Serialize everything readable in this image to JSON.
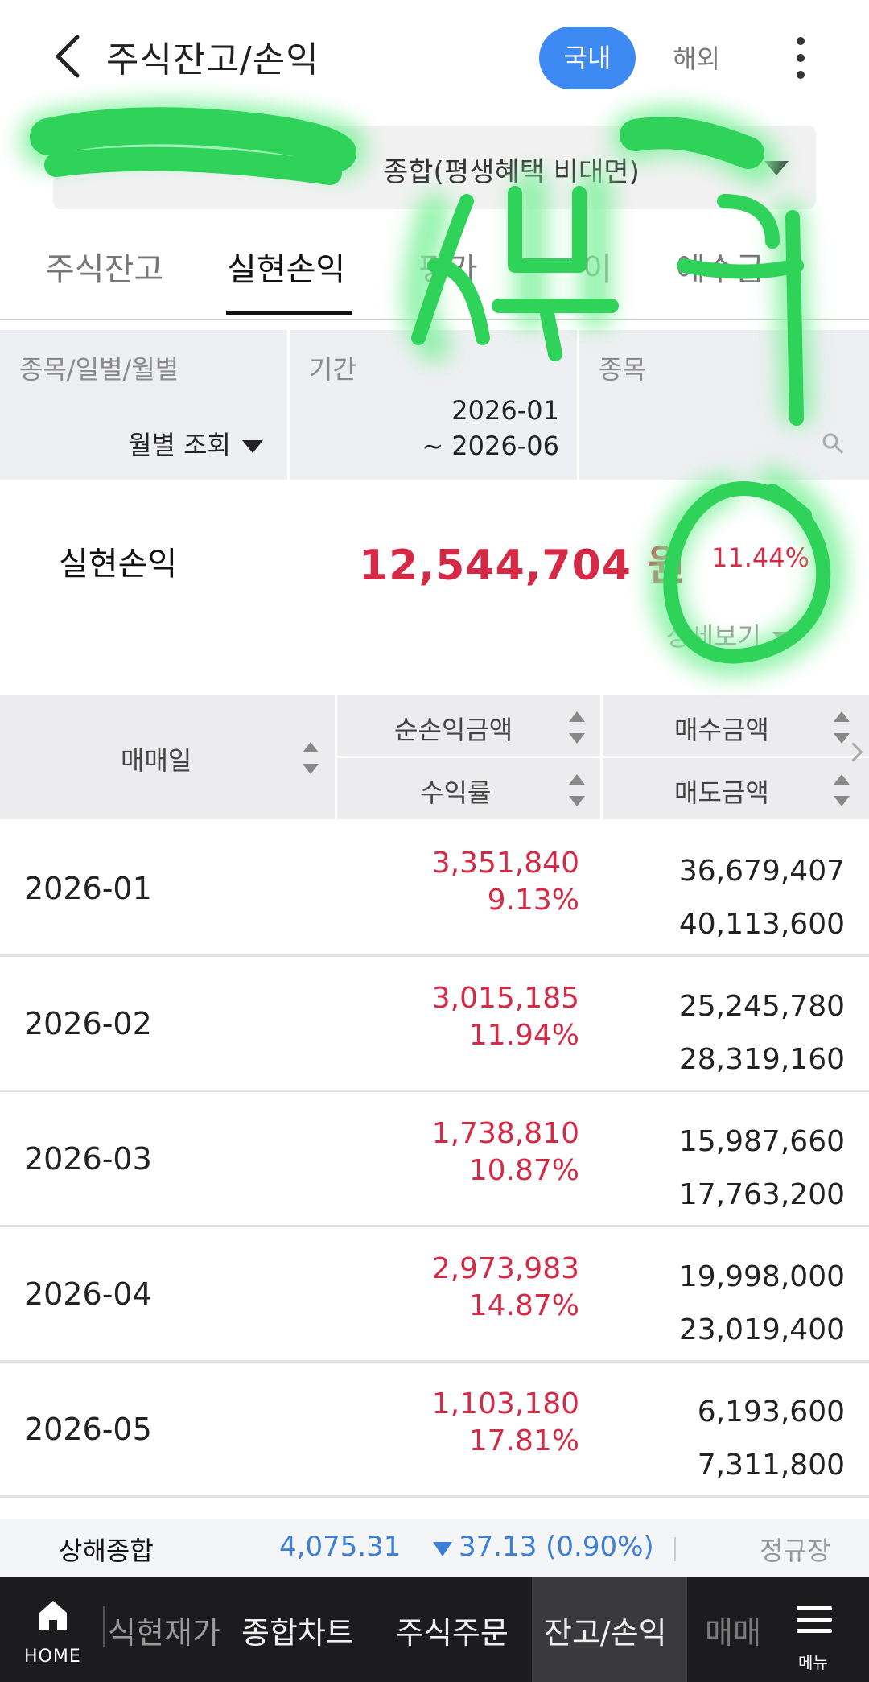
{
  "header": {
    "title": "주식잔고/손익",
    "domestic_label": "국내",
    "overseas_label": "해외"
  },
  "account": {
    "name": "종합(평생혜택 비대면)"
  },
  "tabs": [
    {
      "label": "주식잔고"
    },
    {
      "label": "실현손익"
    },
    {
      "label": "평가"
    },
    {
      "label": "이"
    },
    {
      "label": "예수금"
    }
  ],
  "filters": {
    "type_label": "종목/일별/월별",
    "type_value": "월별 조회",
    "period_label": "기간",
    "period_start": "2026-01",
    "period_end": "~ 2026-06",
    "stock_label": "종목"
  },
  "summary": {
    "label": "실현손익",
    "amount": "12,544,704 원",
    "rate": "11.44%",
    "detail_label": "상세보기"
  },
  "table": {
    "col_date": "매매일",
    "col_net_pnl": "순손익금액",
    "col_rate": "수익률",
    "col_buy": "매수금액",
    "col_sell": "매도금액",
    "rows": [
      {
        "date": "2026-01",
        "pnl": "3,351,840",
        "rate": "9.13%",
        "buy": "36,679,407",
        "sell": "40,113,600"
      },
      {
        "date": "2026-02",
        "pnl": "3,015,185",
        "rate": "11.94%",
        "buy": "25,245,780",
        "sell": "28,319,160"
      },
      {
        "date": "2026-03",
        "pnl": "1,738,810",
        "rate": "10.87%",
        "buy": "15,987,660",
        "sell": "17,763,200"
      },
      {
        "date": "2026-04",
        "pnl": "2,973,983",
        "rate": "14.87%",
        "buy": "19,998,000",
        "sell": "23,019,400"
      },
      {
        "date": "2026-05",
        "pnl": "1,103,180",
        "rate": "17.81%",
        "buy": "6,193,600",
        "sell": "7,311,800"
      }
    ]
  },
  "ticker": {
    "name": "상해종합",
    "value": "4,075.31",
    "change": "37.13 (0.90%)",
    "status": "정규장"
  },
  "bottom_nav": {
    "home": "HOME",
    "items": [
      "식현재가",
      "종합차트",
      "주식주문",
      "잔고/손익",
      "매매"
    ],
    "menu": "메뉴"
  },
  "colors": {
    "accent": "#3d8bf2",
    "profit_red": "#d42a45",
    "index_blue": "#3c7fd8",
    "redaction_green": "#2fd35a"
  },
  "annotation": {
    "handwriting": "상변경"
  }
}
